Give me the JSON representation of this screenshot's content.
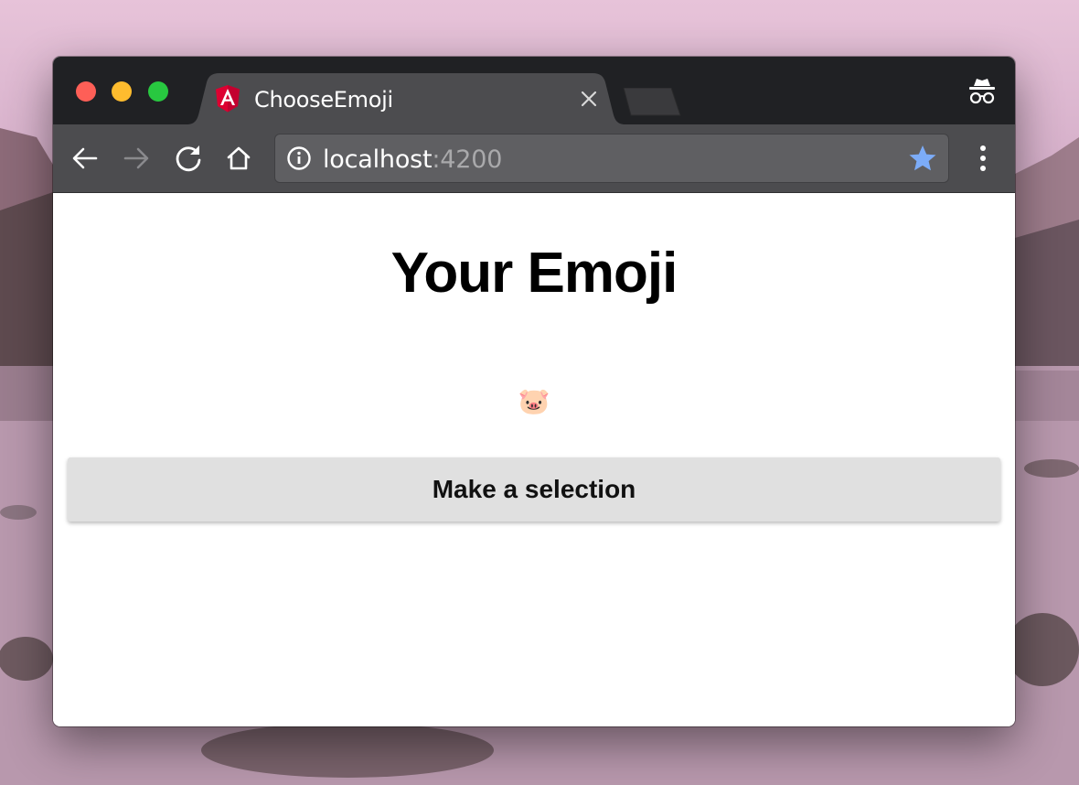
{
  "browser": {
    "tab_title": "ChooseEmoji",
    "favicon": "angular-logo-icon",
    "url_host": "localhost",
    "url_port": ":4200",
    "colors": {
      "titlebar": "#202124",
      "toolbar": "#4c4c4f",
      "star": "#7cacf8",
      "angular_red": "#dd0031"
    }
  },
  "page": {
    "heading": "Your Emoji",
    "emoji": "🐷",
    "button_label": "Make a selection"
  },
  "icons": [
    "close-tab-icon",
    "incognito-icon",
    "back-arrow-icon",
    "forward-arrow-icon",
    "reload-icon",
    "home-icon",
    "info-icon",
    "star-icon",
    "more-menu-icon"
  ]
}
